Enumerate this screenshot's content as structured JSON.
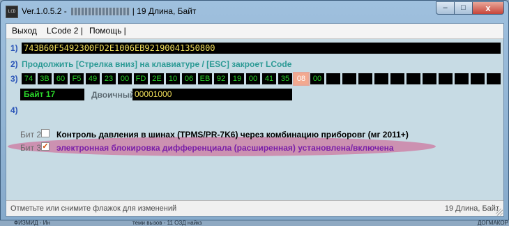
{
  "window": {
    "icon_text": "LCD",
    "title_prefix": "Ver.1.0.5.2 -",
    "title_suffix": "| 19 Длина, Байт",
    "controls": {
      "minimize": "–",
      "maximize": "□",
      "close": "x"
    }
  },
  "menu": {
    "items": [
      "Выход",
      "LCode 2 |",
      "Помощь |"
    ]
  },
  "rows": {
    "row1_label": "1)",
    "hex_code": "743B60F5492300FD2E1006EB92190041350800",
    "row2_label": "2)",
    "row2_text": "Продолжить [Стрелка вниз] на клавиатуре / [ESC] закроет LCode",
    "row3_label": "3)",
    "row4_label": "4)"
  },
  "bytes": {
    "values": [
      "74",
      "3B",
      "60",
      "F5",
      "49",
      "23",
      "00",
      "FD",
      "2E",
      "10",
      "06",
      "EB",
      "92",
      "19",
      "00",
      "41",
      "35",
      "08",
      "00",
      "",
      "",
      "",
      "",
      "",
      "",
      "",
      "",
      "",
      "",
      ""
    ],
    "selected_index": 17,
    "selected_color": "#f3a98f",
    "byte_color": "#2ad62a"
  },
  "byte_detail": {
    "title": "Байт 17",
    "binary_label": "Двоичный:",
    "binary_value": "00001000"
  },
  "bits": [
    {
      "label": "Бит 2",
      "checked": false,
      "mark": "",
      "text": "Контроль давления в шинах (TPMS/PR-7K6) через комбинацию приборовг (мг 2011+)",
      "color": "#000000"
    },
    {
      "label": "Бит 3",
      "checked": true,
      "mark": "✓",
      "text": "электронная блокировка дифференциала (расширенная) установлена/включена",
      "color": "#7a1fa8"
    }
  ],
  "status": {
    "left": "Отметьте или снимите флажок для изменений",
    "right": "19 Длина, Байт"
  },
  "desktop": {
    "left_text": "ФИЗМИД - Ин",
    "middle_text": "теми вызов - 11 ОЗД найкз",
    "right_text": "ДОГМАКОР"
  }
}
